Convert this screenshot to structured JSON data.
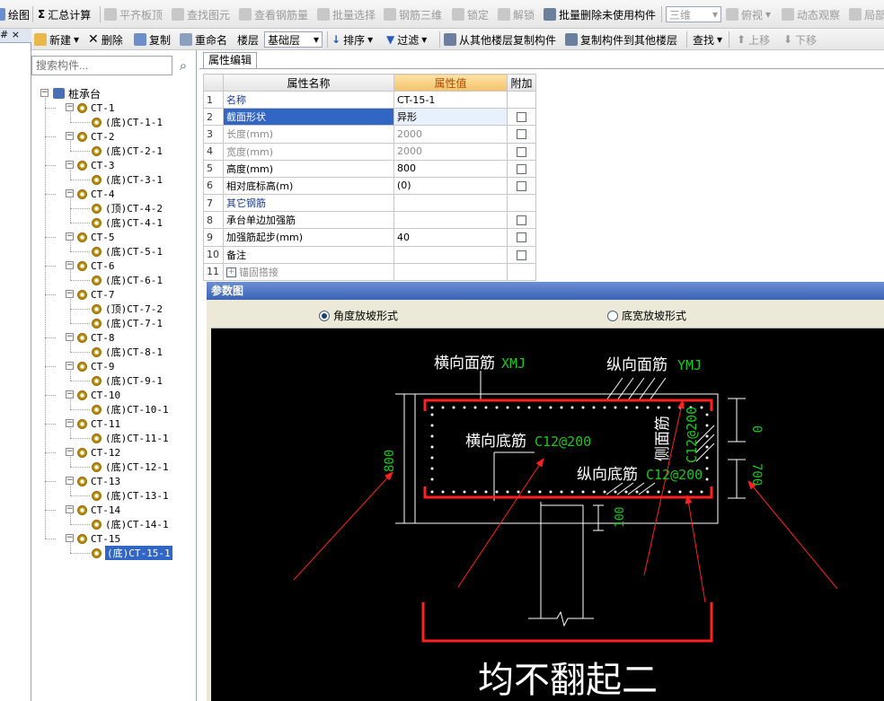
{
  "toolbar1": {
    "draw": "绘图",
    "summary": "汇总计算",
    "align_top": "平齐板顶",
    "find_element": "查找图元",
    "view_rebar": "查看钢筋量",
    "batch_select": "批量选择",
    "rebar_3d": "钢筋三维",
    "lock": "锁定",
    "unlock": "解锁",
    "batch_delete": "批量删除未使用构件",
    "view_mode": "三维",
    "top_view": "俯视",
    "dynamic_view": "动态观察",
    "local": "局部"
  },
  "toolbar2": {
    "new": "新建",
    "delete": "删除",
    "copy": "复制",
    "rename": "重命名",
    "floor_label": "楼层",
    "floor_value": "基础层",
    "sort": "排序",
    "filter": "过滤",
    "copy_from": "从其他楼层复制构件",
    "copy_to": "复制构件到其他楼层",
    "find": "查找",
    "move_up": "上移",
    "move_down": "下移"
  },
  "leftedge": {
    "pin": "# ×"
  },
  "search": {
    "placeholder": "搜索构件..."
  },
  "tree": {
    "root": "桩承台",
    "groups": [
      {
        "name": "CT-1",
        "children": [
          "(底)CT-1-1"
        ]
      },
      {
        "name": "CT-2",
        "children": [
          "(底)CT-2-1"
        ]
      },
      {
        "name": "CT-3",
        "children": [
          "(底)CT-3-1"
        ]
      },
      {
        "name": "CT-4",
        "children": [
          "(顶)CT-4-2",
          "(底)CT-4-1"
        ]
      },
      {
        "name": "CT-5",
        "children": [
          "(底)CT-5-1"
        ]
      },
      {
        "name": "CT-6",
        "children": [
          "(底)CT-6-1"
        ]
      },
      {
        "name": "CT-7",
        "children": [
          "(顶)CT-7-2",
          "(底)CT-7-1"
        ]
      },
      {
        "name": "CT-8",
        "children": [
          "(底)CT-8-1"
        ]
      },
      {
        "name": "CT-9",
        "children": [
          "(底)CT-9-1"
        ]
      },
      {
        "name": "CT-10",
        "children": [
          "(底)CT-10-1"
        ]
      },
      {
        "name": "CT-11",
        "children": [
          "(底)CT-11-1"
        ]
      },
      {
        "name": "CT-12",
        "children": [
          "(底)CT-12-1"
        ]
      },
      {
        "name": "CT-13",
        "children": [
          "(底)CT-13-1"
        ]
      },
      {
        "name": "CT-14",
        "children": [
          "(底)CT-14-1"
        ]
      },
      {
        "name": "CT-15",
        "children": [
          "(底)CT-15-1"
        ]
      }
    ],
    "selected": "(底)CT-15-1"
  },
  "tab": {
    "label": "属性编辑"
  },
  "grid": {
    "headers": [
      "属性名称",
      "属性值",
      "附加"
    ],
    "rows": [
      {
        "n": "1",
        "name": "名称",
        "value": "CT-15-1",
        "add": false,
        "style": "blue"
      },
      {
        "n": "2",
        "name": "截面形状",
        "value": "异形",
        "add": true,
        "style": "sel"
      },
      {
        "n": "3",
        "name": "长度(mm)",
        "value": "2000",
        "add": true,
        "style": "gray"
      },
      {
        "n": "4",
        "name": "宽度(mm)",
        "value": "2000",
        "add": true,
        "style": "gray"
      },
      {
        "n": "5",
        "name": "高度(mm)",
        "value": "800",
        "add": true,
        "style": ""
      },
      {
        "n": "6",
        "name": "相对底标高(m)",
        "value": "(0)",
        "add": true,
        "style": ""
      },
      {
        "n": "7",
        "name": "其它钢筋",
        "value": "",
        "add": false,
        "style": "blue"
      },
      {
        "n": "8",
        "name": "承台单边加强筋",
        "value": "",
        "add": true,
        "style": ""
      },
      {
        "n": "9",
        "name": "加强筋起步(mm)",
        "value": "40",
        "add": true,
        "style": ""
      },
      {
        "n": "10",
        "name": "备注",
        "value": "",
        "add": true,
        "style": ""
      },
      {
        "n": "11",
        "name": "锚固搭接",
        "value": "",
        "add": false,
        "style": "gray",
        "expand": "+"
      }
    ]
  },
  "param": {
    "title": "参数图",
    "radio_angle": "角度放坡形式",
    "radio_width": "底宽放坡形式",
    "selected": "angle"
  },
  "drawing": {
    "label_top_h": "横向面筋",
    "label_top_h_code": "XMJ",
    "label_top_v": "纵向面筋",
    "label_top_v_code": "YMJ",
    "label_bottom_h": "横向底筋",
    "label_bottom_h_code": "C12@200",
    "label_bottom_v": "纵向底筋",
    "label_bottom_v_code": "C12@200",
    "label_side": "侧面筋",
    "label_side_code": "C12@200",
    "dim_height": "800",
    "dim_top": "0",
    "dim_bottom": "700",
    "dim_pile": "100",
    "annotation": "均不翻起二",
    "colors": {
      "rebar": "#ff2020",
      "dim": "#19c819",
      "line": "#ffffff"
    }
  }
}
